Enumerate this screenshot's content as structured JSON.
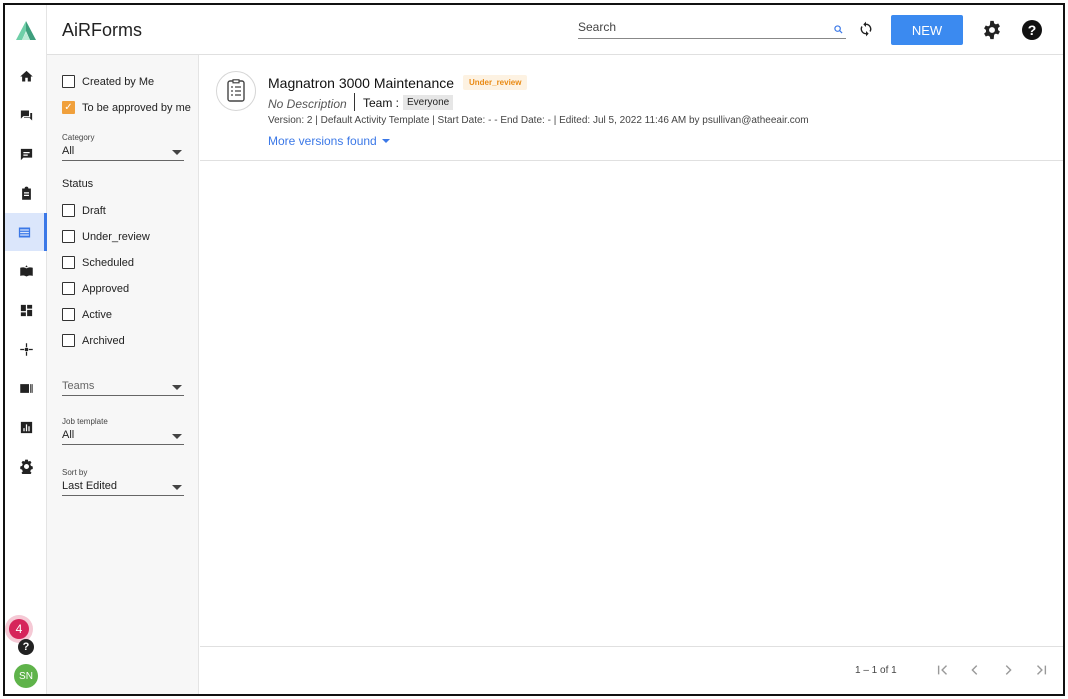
{
  "app": {
    "title": "AiRForms"
  },
  "header": {
    "search_label": "Search",
    "new_label": "NEW"
  },
  "rail": {
    "items": [
      "home-icon",
      "forum-icon",
      "chat-icon",
      "clipboard-icon",
      "forms-icon",
      "book-icon",
      "dashboard-icon",
      "hub-icon",
      "id-card-icon",
      "bar-chart-icon",
      "settings-icon"
    ],
    "active_index": 4,
    "notification_count": "4",
    "help_glyph": "?",
    "avatar_initials": "SN"
  },
  "filters": {
    "created_by_me": "Created by Me",
    "to_be_approved": "To be approved by me",
    "category_caption": "Category",
    "category_value": "All",
    "status_heading": "Status",
    "statuses": [
      "Draft",
      "Under_review",
      "Scheduled",
      "Approved",
      "Active",
      "Archived"
    ],
    "teams_placeholder": "Teams",
    "job_template_caption": "Job template",
    "job_template_value": "All",
    "sort_caption": "Sort by",
    "sort_value": "Last Edited"
  },
  "card": {
    "title": "Magnatron 3000 Maintenance",
    "status": "Under_review",
    "description": "No Description",
    "team_label": "Team :",
    "team_value": "Everyone",
    "meta": "Version: 2 |  Default Activity Template |  Start Date:  -  -   End Date:  -  |  Edited: Jul 5, 2022 11:46 AM by psullivan@atheeair.com",
    "more_versions": "More versions found"
  },
  "pagination": {
    "range": "1 – 1 of 1"
  },
  "colors": {
    "accent": "#3b8af0",
    "status_orange": "#e98a14",
    "checkbox_checked": "#f0a03c",
    "badge": "#d6245a",
    "avatar": "#5fb34a"
  }
}
